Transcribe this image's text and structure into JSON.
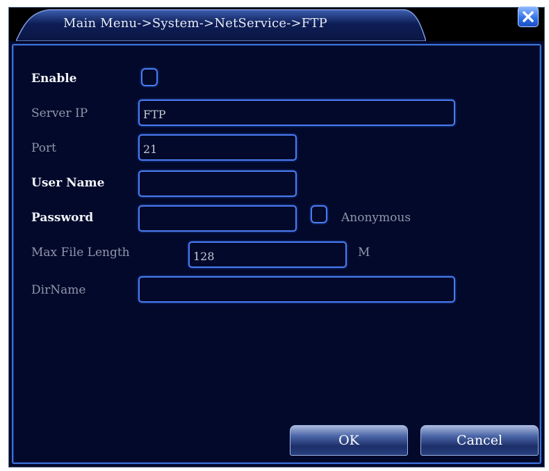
{
  "title": "Main Menu->System->NetService->FTP",
  "colors": {
    "background": "#02092a",
    "accent": "#4a7cf0",
    "close_button": "#2f6fe6"
  },
  "close_icon": "close-icon",
  "form": {
    "enable": {
      "label": "Enable",
      "checked": false
    },
    "server_ip": {
      "label": "Server IP",
      "value": "FTP"
    },
    "port": {
      "label": "Port",
      "value": "21"
    },
    "user_name": {
      "label": "User Name",
      "value": ""
    },
    "password": {
      "label": "Password",
      "value": ""
    },
    "anonymous": {
      "label": "Anonymous",
      "checked": false
    },
    "max_file_length": {
      "label": "Max File Length",
      "value": "128",
      "unit": "M"
    },
    "dir_name": {
      "label": "DirName",
      "value": ""
    }
  },
  "buttons": {
    "ok": "OK",
    "cancel": "Cancel"
  }
}
